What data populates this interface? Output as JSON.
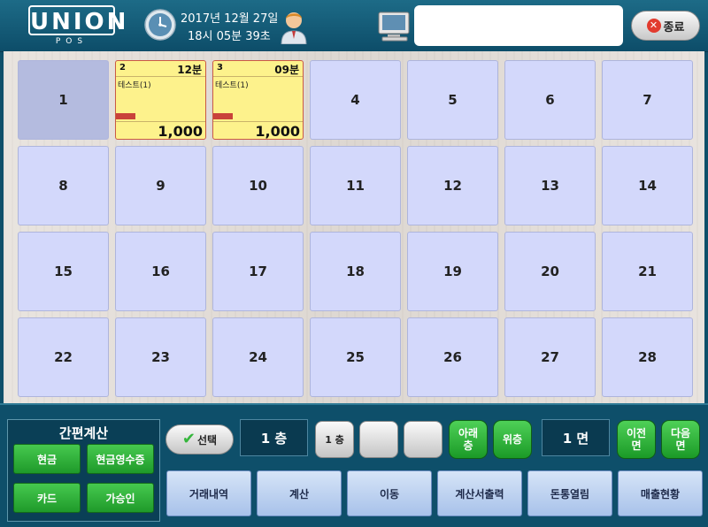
{
  "header": {
    "logo_text": "UNION",
    "logo_sub": "POS",
    "date": "2017년 12월 27일",
    "time": "18시 05분 39초",
    "message": "",
    "exit_label": "종료"
  },
  "tables": [
    {
      "label": "1"
    },
    {
      "number": "2",
      "elapsed": "12분",
      "item": "테스트(1)",
      "amount": "1,000"
    },
    {
      "number": "3",
      "elapsed": "09분",
      "item": "테스트(1)",
      "amount": "1,000"
    },
    {
      "label": "4"
    },
    {
      "label": "5"
    },
    {
      "label": "6"
    },
    {
      "label": "7"
    },
    {
      "label": "8"
    },
    {
      "label": "9"
    },
    {
      "label": "10"
    },
    {
      "label": "11"
    },
    {
      "label": "12"
    },
    {
      "label": "13"
    },
    {
      "label": "14"
    },
    {
      "label": "15"
    },
    {
      "label": "16"
    },
    {
      "label": "17"
    },
    {
      "label": "18"
    },
    {
      "label": "19"
    },
    {
      "label": "20"
    },
    {
      "label": "21"
    },
    {
      "label": "22"
    },
    {
      "label": "23"
    },
    {
      "label": "24"
    },
    {
      "label": "25"
    },
    {
      "label": "26"
    },
    {
      "label": "27"
    },
    {
      "label": "28"
    }
  ],
  "quick_pay": {
    "title": "간편계산",
    "cash": "현금",
    "cash_receipt": "현금영수증",
    "card": "카드",
    "preapproval": "가승인"
  },
  "controls": {
    "select": "선택",
    "floor_display": "1 층",
    "floor_tab_1": "1 층",
    "floor_tab_2": "",
    "floor_tab_3": "",
    "floor_down": "아래\n층",
    "floor_up": "위층",
    "page_display": "1 면",
    "prev_page": "이전\n면",
    "next_page": "다음\n면"
  },
  "actions": [
    {
      "label": "거래내역"
    },
    {
      "label": "계산"
    },
    {
      "label": "이동"
    },
    {
      "label": "계산서출력"
    },
    {
      "label": "돈통열림"
    },
    {
      "label": "매출현황"
    }
  ],
  "colors": {
    "panel_bg": "#0e4f6a",
    "table_empty": "#d3d8fb",
    "table_selected": "#b4bbdf",
    "table_occupied": "#fdf28c",
    "action_green": "#2fb03a",
    "exit_red": "#e23b2e"
  },
  "icons": [
    "clock-icon",
    "user-icon",
    "monitor-icon",
    "close-circle-icon",
    "check-icon"
  ]
}
